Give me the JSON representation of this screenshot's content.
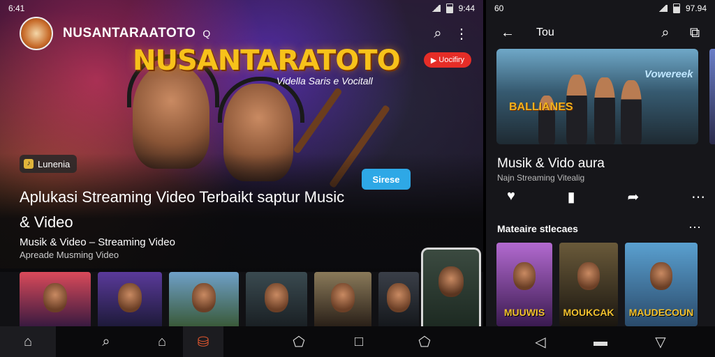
{
  "left": {
    "status": {
      "time": "6:41",
      "right": "9:44"
    },
    "app": {
      "brand": "NUSANTARAATOTO",
      "brand_suffix": "Q"
    },
    "hero": {
      "art_title": "NUSANTARATOTO",
      "art_subtitle": "Vidella Saris e Vocitall",
      "yt_badge": "Uocifiry",
      "chip_label": "Lunenia",
      "action_label": "Sirese",
      "headline": "Aplukasi Streaming Video Terbaikt saptur Music & Video",
      "meta_title": "Musik & Video – Streaming Video",
      "meta_sub": "Apreade Musming Video"
    },
    "thumbs": [
      "#c0394f",
      "#3a2a6a",
      "#4a6a8a",
      "#2f3a3f",
      "#5a4a3a",
      "#262a30"
    ]
  },
  "right": {
    "status": {
      "left": "60",
      "right": "97.94"
    },
    "header_title": "Tou",
    "feature": {
      "logo_left": "BALLIANES",
      "logo_right": "Vowereek"
    },
    "title": "Musik & Vido aura",
    "subtitle": "Najn Streaming Vitealig",
    "section_title": "Mateaire stlecaes",
    "thumbs": [
      {
        "label": "MUUWIS",
        "bg": "#7a3a9a"
      },
      {
        "label": "MOUKCAK",
        "bg": "#4a3a2a"
      },
      {
        "label": "MAUDECOUN",
        "bg": "#2a6aa0"
      }
    ]
  },
  "icons": {
    "back": "←",
    "search": "⌕",
    "more": "⋮",
    "heart": "♥",
    "comment": "▮",
    "share": "➦",
    "dots": "⋯",
    "home": "⌂",
    "square": "□",
    "triangle": "◁",
    "pentagon": "⬠"
  }
}
